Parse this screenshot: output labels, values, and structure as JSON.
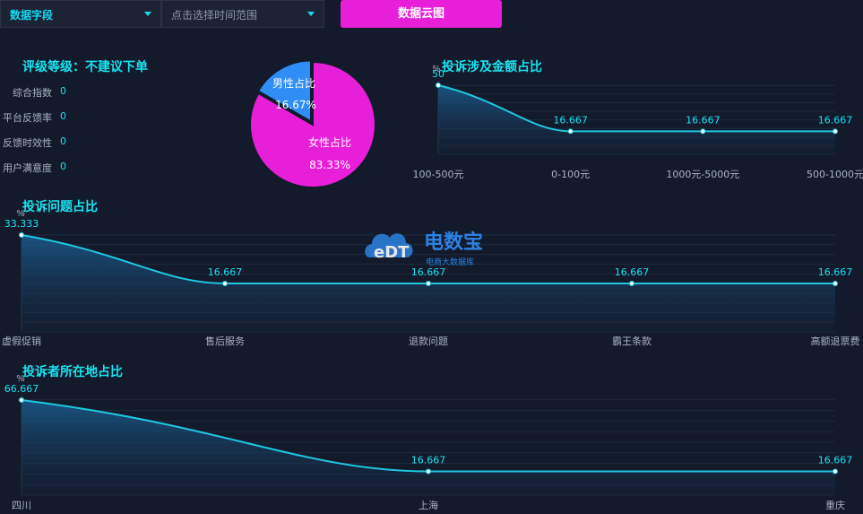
{
  "toolbar": {
    "field_select": "数据字段",
    "time_placeholder": "点击选择时间范围",
    "cloud_button": "数据云图"
  },
  "rating": {
    "title": "评级等级：不建议下单",
    "metrics": [
      {
        "label": "综合指数",
        "value": "0"
      },
      {
        "label": "平台反馈率",
        "value": "0"
      },
      {
        "label": "反馈时效性",
        "value": "0"
      },
      {
        "label": "用户满意度",
        "value": "0"
      }
    ]
  },
  "watermark": {
    "main": "电数宝",
    "sub": "电商大数据库",
    "logo": "eDT"
  },
  "colors": {
    "background": "#121a2b",
    "accent": "#19e3f2",
    "line": "#1ec8e0",
    "pie_male": "#2f8ef6",
    "pie_female": "#e81fd8",
    "button": "#e81fd8"
  },
  "chart_data": [
    {
      "id": "gender",
      "type": "pie",
      "slices": [
        {
          "name": "男性占比",
          "value": 16.67,
          "label": "16.67%",
          "color": "#2f8ef6"
        },
        {
          "name": "女性占比",
          "value": 83.33,
          "label": "83.33%",
          "color": "#e81fd8"
        }
      ]
    },
    {
      "id": "amount",
      "type": "area",
      "title": "投诉涉及金额占比",
      "ylabel": "%",
      "categories": [
        "100-500元",
        "0-100元",
        "1000元-5000元",
        "500-1000元"
      ],
      "values": [
        50,
        16.667,
        16.667,
        16.667
      ],
      "ylim": [
        0,
        50
      ]
    },
    {
      "id": "issues",
      "type": "area",
      "title": "投诉问题占比",
      "ylabel": "%",
      "categories": [
        "虚假促销",
        "售后服务",
        "退款问题",
        "霸王条款",
        "高额退票费"
      ],
      "values": [
        33.333,
        16.667,
        16.667,
        16.667,
        16.667
      ],
      "ylim": [
        0,
        33.333
      ]
    },
    {
      "id": "region",
      "type": "area",
      "title": "投诉者所在地占比",
      "ylabel": "%",
      "categories": [
        "四川",
        "上海",
        "重庆"
      ],
      "values": [
        66.667,
        16.667,
        16.667
      ],
      "ylim": [
        0,
        66.667
      ]
    }
  ]
}
